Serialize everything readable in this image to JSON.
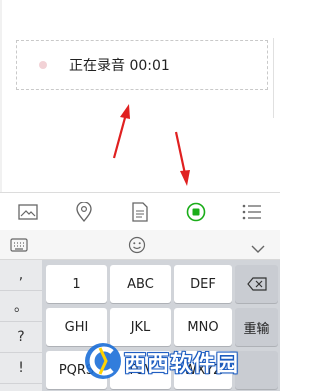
{
  "recording": {
    "status_text": "正在录音 00:01"
  },
  "toolbar": {
    "items": [
      "image",
      "location",
      "file",
      "record",
      "list"
    ]
  },
  "keyboard": {
    "side_keys": [
      ",",
      "。",
      "?",
      "!"
    ],
    "rows": [
      [
        "1",
        "ABC",
        "DEF"
      ],
      [
        "GHI",
        "JKL",
        "MNO"
      ],
      [
        "PQRS",
        "TUV",
        "WXYZ"
      ]
    ],
    "reenter_label": "重输"
  },
  "watermark": {
    "text": "西西软件园"
  },
  "colors": {
    "accent_green": "#1aad19",
    "arrow_red": "#e02020"
  }
}
